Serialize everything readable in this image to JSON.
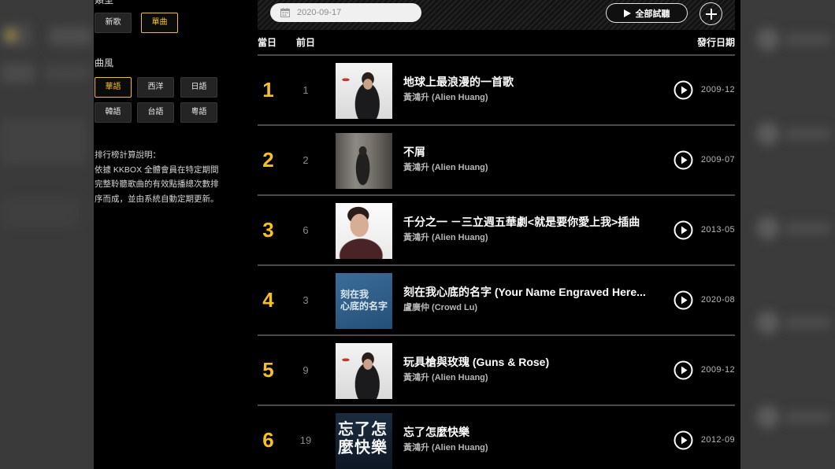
{
  "sidebar": {
    "type_label": "類型",
    "type_options": [
      {
        "label": "新歌",
        "selected": false
      },
      {
        "label": "單曲",
        "selected": true
      }
    ],
    "genre_label": "曲風",
    "genre_options": [
      {
        "label": "華語",
        "selected": true
      },
      {
        "label": "西洋",
        "selected": false
      },
      {
        "label": "日語",
        "selected": false
      },
      {
        "label": "韓語",
        "selected": false
      },
      {
        "label": "台語",
        "selected": false
      },
      {
        "label": "粵語",
        "selected": false
      }
    ],
    "description": {
      "heading": "排行榜計算說明：",
      "lines": [
        "依據 KKBOX 全體會員在特定期間",
        "完整聆聽歌曲的有效點播總次數排",
        "序而成，並由系統自動定期更新。"
      ]
    }
  },
  "toolbar": {
    "date": "2020-09-17",
    "date_icon": "calendar-icon",
    "play_all_icon": "play-icon",
    "play_all_label": "全部試聽",
    "add_icon": "plus-icon"
  },
  "table": {
    "headers": {
      "today": "當日",
      "previous": "前日",
      "release_date": "發行日期"
    },
    "row_action_icon": "play-circle-icon",
    "rows": [
      {
        "rank": "1",
        "previous": "1",
        "title": "地球上最浪漫的一首歌",
        "artist": "黃鴻升 (Alien Huang)",
        "release_date": "2009-12"
      },
      {
        "rank": "2",
        "previous": "2",
        "title": "不屑",
        "artist": "黃鴻升 (Alien Huang)",
        "release_date": "2009-07"
      },
      {
        "rank": "3",
        "previous": "6",
        "title": "千分之一 －三立週五華劇<就是要你愛上我>插曲",
        "artist": "黃鴻升 (Alien Huang)",
        "release_date": "2013-05"
      },
      {
        "rank": "4",
        "previous": "3",
        "title": "刻在我心底的名字 (Your Name Engraved Here...",
        "artist": "盧廣仲 (Crowd Lu)",
        "release_date": "2020-08",
        "cover_text": [
          "刻在我",
          "心底的名字"
        ]
      },
      {
        "rank": "5",
        "previous": "9",
        "title": "玩具槍與玫瑰 (Guns & Rose)",
        "artist": "黃鴻升 (Alien Huang)",
        "release_date": "2009-12"
      },
      {
        "rank": "6",
        "previous": "19",
        "title": "忘了怎麼快樂",
        "artist": "黃鴻升 (Alien Huang)",
        "release_date": "2012-09",
        "cover_text": [
          "忘了怎",
          "麼快樂"
        ]
      }
    ]
  },
  "colors": {
    "accent": "#f4c025",
    "divider": "#4a4a4a"
  }
}
